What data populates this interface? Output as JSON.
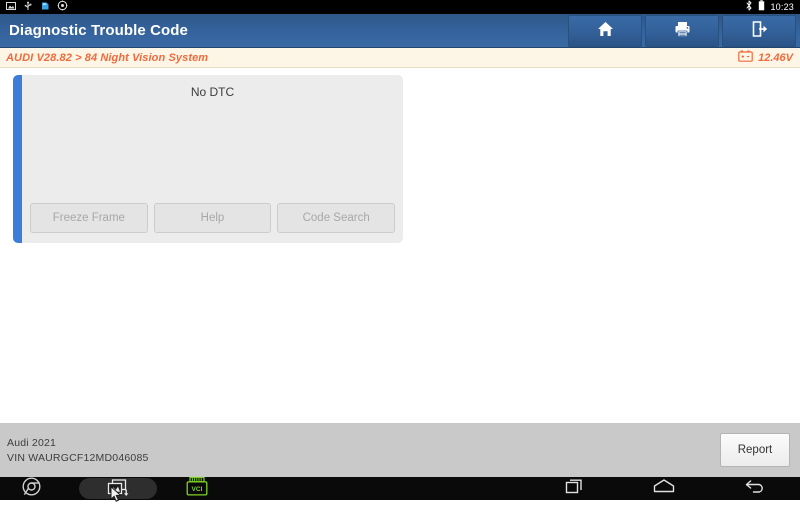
{
  "status_bar": {
    "icons_left": [
      "image-icon",
      "usb-icon",
      "sdcard-icon",
      "settings-icon"
    ],
    "bluetooth_icon": "bluetooth-icon",
    "battery_icon": "battery-icon",
    "time": "10:23"
  },
  "header": {
    "title": "Diagnostic Trouble Code",
    "buttons": [
      {
        "name": "home-button",
        "icon": "home-icon"
      },
      {
        "name": "print-button",
        "icon": "printer-icon"
      },
      {
        "name": "exit-button",
        "icon": "exit-icon"
      }
    ]
  },
  "path_bar": {
    "breadcrumb": "AUDI V28.82 > 84 Night Vision System",
    "battery_icon": "car-battery-icon",
    "voltage": "12.46V"
  },
  "main": {
    "panel": {
      "message": "No DTC",
      "accent_color": "#3b7dd8",
      "buttons": [
        {
          "label": "Freeze Frame",
          "enabled": false
        },
        {
          "label": "Help",
          "enabled": false
        },
        {
          "label": "Code Search",
          "enabled": false
        }
      ]
    }
  },
  "info_bar": {
    "vehicle": "Audi  2021",
    "vin": "VIN WAURGCF12MD046085",
    "report_label": "Report"
  },
  "nav_bar": {
    "items": [
      {
        "name": "browser-icon",
        "label": ""
      },
      {
        "name": "screenshot-icon",
        "label": ""
      },
      {
        "name": "vci-icon",
        "label": "VCI"
      },
      {
        "name": "recents-icon",
        "label": ""
      },
      {
        "name": "home-nav-icon",
        "label": ""
      },
      {
        "name": "back-icon",
        "label": ""
      }
    ],
    "vci_label": "VCI"
  },
  "colors": {
    "header_blue": "#34619a",
    "accent_blue": "#3b7dd8",
    "path_orange": "#ef6a3d",
    "panel_gray": "#ececec",
    "footer_gray": "#c9c9c9",
    "vci_green": "#7ed321"
  }
}
